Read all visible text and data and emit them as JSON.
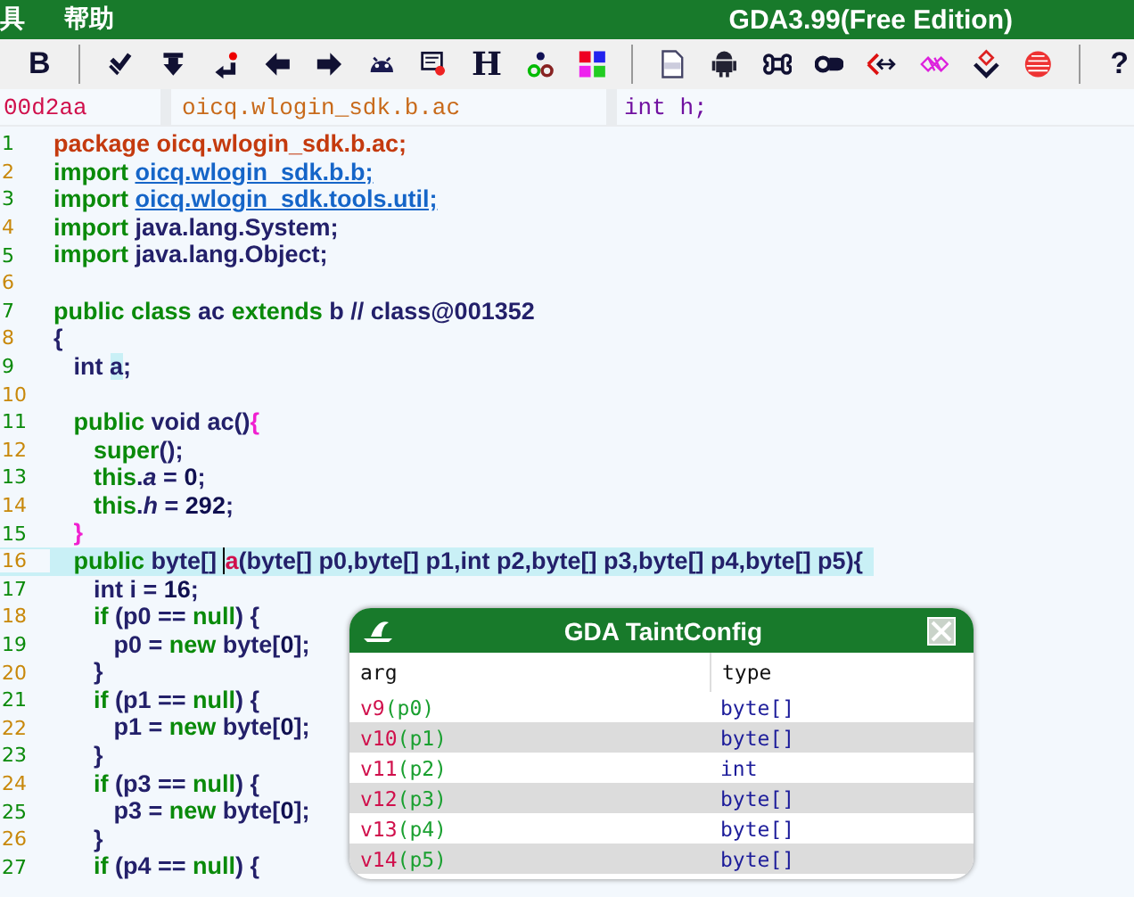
{
  "menu": {
    "items": [
      "具",
      "帮助"
    ],
    "title": "GDA3.99(Free Edition)"
  },
  "toolbar": [
    {
      "kind": "glyph",
      "text": "B"
    },
    {
      "kind": "sep"
    },
    {
      "kind": "icon"
    },
    {
      "kind": "icon"
    },
    {
      "kind": "icon"
    },
    {
      "kind": "icon"
    },
    {
      "kind": "icon"
    },
    {
      "kind": "icon"
    },
    {
      "kind": "icon"
    },
    {
      "kind": "glyph",
      "text": "H"
    },
    {
      "kind": "icon"
    },
    {
      "kind": "icon"
    },
    {
      "kind": "sep"
    },
    {
      "kind": "icon"
    },
    {
      "kind": "icon"
    },
    {
      "kind": "icon"
    },
    {
      "kind": "icon"
    },
    {
      "kind": "icon"
    },
    {
      "kind": "icon"
    },
    {
      "kind": "icon"
    },
    {
      "kind": "icon"
    },
    {
      "kind": "sep"
    },
    {
      "kind": "glyph",
      "text": "?"
    }
  ],
  "address_bar": {
    "offset": "00d2aa",
    "class_name": "oicq.wlogin_sdk.b.ac",
    "member": "int h;"
  },
  "code": [
    {
      "n": "1",
      "selected": false,
      "t": [
        {
          "kind": "pk",
          "text": "package oicq.wlogin_sdk.b.ac;"
        }
      ]
    },
    {
      "n": "2",
      "selected": false,
      "t": [
        {
          "kind": "k",
          "text": "import "
        },
        {
          "kind": "l",
          "text": "oicq.wlogin_sdk.b.b;"
        }
      ]
    },
    {
      "n": "3",
      "selected": false,
      "t": [
        {
          "kind": "k",
          "text": "import "
        },
        {
          "kind": "l",
          "text": "oicq.wlogin_sdk.tools.util;"
        }
      ]
    },
    {
      "n": "4",
      "selected": false,
      "t": [
        {
          "kind": "k",
          "text": "import"
        },
        {
          "kind": "p",
          "text": " java.lang.System;"
        }
      ]
    },
    {
      "n": "5",
      "selected": false,
      "t": [
        {
          "kind": "k",
          "text": "import"
        },
        {
          "kind": "p",
          "text": " java.lang.Object;"
        }
      ]
    },
    {
      "n": "6",
      "selected": false
    },
    {
      "n": "7",
      "selected": false,
      "t": [
        {
          "kind": "k",
          "text": "public class"
        },
        {
          "kind": "p",
          "text": " ac "
        },
        {
          "kind": "k",
          "text": "extends"
        },
        {
          "kind": "p",
          "text": " b // class@001352"
        }
      ]
    },
    {
      "n": "8",
      "selected": false,
      "t": [
        {
          "kind": "p",
          "text": "{"
        }
      ]
    },
    {
      "n": "9",
      "selected": false,
      "t": [
        {
          "kind": "p",
          "text": "   int "
        },
        {
          "kind": "h",
          "text": "a"
        },
        {
          "kind": "p",
          "text": ";"
        }
      ]
    },
    {
      "n": "10",
      "selected": false
    },
    {
      "n": "11",
      "selected": false,
      "t": [
        {
          "kind": "k",
          "text": "   public"
        },
        {
          "kind": "p",
          "text": " void ac()"
        },
        {
          "kind": "b",
          "text": "{"
        }
      ]
    },
    {
      "n": "12",
      "selected": false,
      "t": [
        {
          "kind": "k",
          "text": "      super"
        },
        {
          "kind": "p",
          "text": "();"
        }
      ]
    },
    {
      "n": "13",
      "selected": false,
      "t": [
        {
          "kind": "k",
          "text": "      this"
        },
        {
          "kind": "p",
          "text": "."
        },
        {
          "kind": "f",
          "text": "a"
        },
        {
          "kind": "p",
          "text": " = "
        },
        {
          "kind": "n",
          "text": "0"
        },
        {
          "kind": "p",
          "text": ";"
        }
      ]
    },
    {
      "n": "14",
      "selected": false,
      "t": [
        {
          "kind": "k",
          "text": "      this"
        },
        {
          "kind": "p",
          "text": "."
        },
        {
          "kind": "f",
          "text": "h"
        },
        {
          "kind": "p",
          "text": " = "
        },
        {
          "kind": "n",
          "text": "292"
        },
        {
          "kind": "p",
          "text": ";"
        }
      ]
    },
    {
      "n": "15",
      "selected": false,
      "t": [
        {
          "kind": "b",
          "text": "   }"
        }
      ]
    },
    {
      "n": "16",
      "selected": true,
      "t": [
        {
          "kind": "k",
          "text": "   public"
        },
        {
          "kind": "p",
          "text": " byte[] "
        },
        {
          "kind": "m",
          "text": "a"
        },
        {
          "kind": "p",
          "text": "(byte[] p0,byte[] p1,int p2,byte[] p3,byte[] p4,byte[] p5){"
        }
      ]
    },
    {
      "n": "17",
      "selected": false,
      "t": [
        {
          "kind": "p",
          "text": "      int i = "
        },
        {
          "kind": "n",
          "text": "16"
        },
        {
          "kind": "p",
          "text": ";"
        }
      ]
    },
    {
      "n": "18",
      "selected": false,
      "t": [
        {
          "kind": "k",
          "text": "      if"
        },
        {
          "kind": "p",
          "text": " (p0 == "
        },
        {
          "kind": "k",
          "text": "null"
        },
        {
          "kind": "p",
          "text": ") {"
        }
      ]
    },
    {
      "n": "19",
      "selected": false,
      "t": [
        {
          "kind": "p",
          "text": "         p0 = "
        },
        {
          "kind": "k",
          "text": "new"
        },
        {
          "kind": "p",
          "text": " byte["
        },
        {
          "kind": "n",
          "text": "0"
        },
        {
          "kind": "p",
          "text": "];"
        }
      ]
    },
    {
      "n": "20",
      "selected": false,
      "t": [
        {
          "kind": "p",
          "text": "      }"
        }
      ]
    },
    {
      "n": "21",
      "selected": false,
      "t": [
        {
          "kind": "k",
          "text": "      if"
        },
        {
          "kind": "p",
          "text": " (p1 == "
        },
        {
          "kind": "k",
          "text": "null"
        },
        {
          "kind": "p",
          "text": ") {"
        }
      ]
    },
    {
      "n": "22",
      "selected": false,
      "t": [
        {
          "kind": "p",
          "text": "         p1 = "
        },
        {
          "kind": "k",
          "text": "new"
        },
        {
          "kind": "p",
          "text": " byte["
        },
        {
          "kind": "n",
          "text": "0"
        },
        {
          "kind": "p",
          "text": "];"
        }
      ]
    },
    {
      "n": "23",
      "selected": false,
      "t": [
        {
          "kind": "p",
          "text": "      }"
        }
      ]
    },
    {
      "n": "24",
      "selected": false,
      "t": [
        {
          "kind": "k",
          "text": "      if"
        },
        {
          "kind": "p",
          "text": " (p3 == "
        },
        {
          "kind": "k",
          "text": "null"
        },
        {
          "kind": "p",
          "text": ") {"
        }
      ]
    },
    {
      "n": "25",
      "selected": false,
      "t": [
        {
          "kind": "p",
          "text": "         p3 = "
        },
        {
          "kind": "k",
          "text": "new"
        },
        {
          "kind": "p",
          "text": " byte["
        },
        {
          "kind": "n",
          "text": "0"
        },
        {
          "kind": "p",
          "text": "];"
        }
      ]
    },
    {
      "n": "26",
      "selected": false,
      "t": [
        {
          "kind": "p",
          "text": "      }"
        }
      ]
    },
    {
      "n": "27",
      "selected": false,
      "t": [
        {
          "kind": "k",
          "text": "      if"
        },
        {
          "kind": "p",
          "text": " (p4 == "
        },
        {
          "kind": "k",
          "text": "null"
        },
        {
          "kind": "p",
          "text": ") {"
        }
      ]
    }
  ],
  "dialog": {
    "title": "GDA TaintConfig",
    "columns": [
      "arg",
      "type"
    ],
    "rows": [
      {
        "reg": "v9",
        "param": "(p0)",
        "type": "byte[]"
      },
      {
        "reg": "v10",
        "param": "(p1)",
        "type": "byte[]"
      },
      {
        "reg": "v11",
        "param": "(p2)",
        "type": "int"
      },
      {
        "reg": "v12",
        "param": "(p3)",
        "type": "byte[]"
      },
      {
        "reg": "v13",
        "param": "(p4)",
        "type": "byte[]"
      },
      {
        "reg": "v14",
        "param": "(p5)",
        "type": "byte[]"
      }
    ]
  }
}
